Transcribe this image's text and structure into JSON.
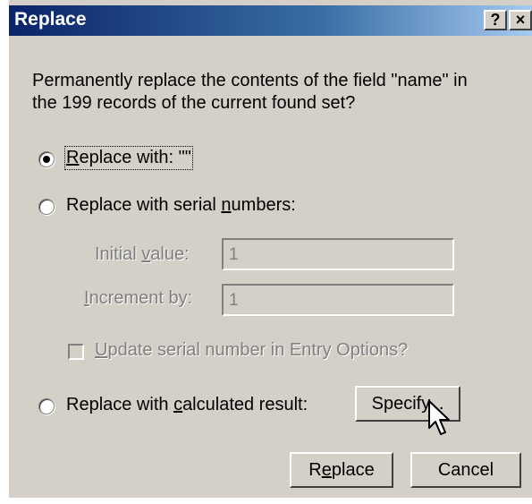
{
  "window": {
    "title": "Replace",
    "help_label": "?",
    "close_label": "×"
  },
  "prompt": "Permanently replace the contents of the field \"name\" in the 199 records of the current found set?",
  "options": {
    "replace_with": {
      "access_key": "R",
      "label_rest": "eplace with: \"\"",
      "selected": true
    },
    "serial": {
      "label_pre": "Replace with serial ",
      "access_key": "n",
      "label_rest": "umbers:",
      "selected": false,
      "initial": {
        "label_pre": "Initial ",
        "access_key": "v",
        "label_rest": "alue:",
        "value": "1"
      },
      "increment": {
        "access_key": "I",
        "label_rest": "ncrement by:",
        "value": "1"
      },
      "update": {
        "access_key": "U",
        "label_rest": "pdate serial number in Entry Options?",
        "checked": false
      }
    },
    "calculated": {
      "label_pre": "Replace with ",
      "access_key": "c",
      "label_rest": "alculated result:",
      "selected": false
    }
  },
  "buttons": {
    "specify": "Specify...",
    "replace_pre": "R",
    "replace_key": "e",
    "replace_rest": "place",
    "cancel": "Cancel"
  }
}
